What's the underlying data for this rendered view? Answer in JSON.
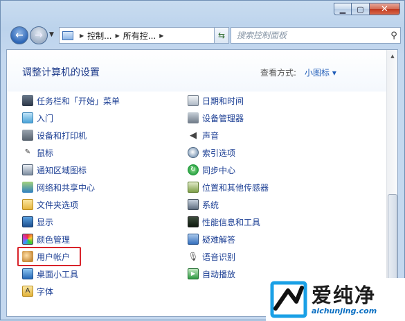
{
  "address": {
    "crumbs": [
      "控制...",
      "所有控..."
    ],
    "search_placeholder": "搜索控制面板"
  },
  "header": {
    "title": "调整计算机的设置",
    "view_by_label": "查看方式:",
    "view_mode": "小图标 ▾"
  },
  "items": {
    "left": [
      {
        "label": "任务栏和「开始」菜单",
        "icon": "taskbar-icon"
      },
      {
        "label": "入门",
        "icon": "getting-started-icon"
      },
      {
        "label": "设备和打印机",
        "icon": "printer-icon"
      },
      {
        "label": "鼠标",
        "icon": "mouse-icon"
      },
      {
        "label": "通知区域图标",
        "icon": "notification-icon"
      },
      {
        "label": "网络和共享中心",
        "icon": "network-icon"
      },
      {
        "label": "文件夹选项",
        "icon": "folder-icon"
      },
      {
        "label": "显示",
        "icon": "display-icon"
      },
      {
        "label": "颜色管理",
        "icon": "color-management-icon"
      },
      {
        "label": "用户帐户",
        "icon": "user-accounts-icon"
      },
      {
        "label": "桌面小工具",
        "icon": "gadgets-icon"
      },
      {
        "label": "字体",
        "icon": "fonts-icon"
      }
    ],
    "right": [
      {
        "label": "日期和时间",
        "icon": "clock-icon"
      },
      {
        "label": "设备管理器",
        "icon": "device-manager-icon"
      },
      {
        "label": "声音",
        "icon": "speaker-icon"
      },
      {
        "label": "索引选项",
        "icon": "indexing-icon"
      },
      {
        "label": "同步中心",
        "icon": "sync-icon"
      },
      {
        "label": "位置和其他传感器",
        "icon": "sensor-icon"
      },
      {
        "label": "系统",
        "icon": "system-icon"
      },
      {
        "label": "性能信息和工具",
        "icon": "performance-icon"
      },
      {
        "label": "疑难解答",
        "icon": "troubleshoot-icon"
      },
      {
        "label": "语音识别",
        "icon": "microphone-icon"
      },
      {
        "label": "自动播放",
        "icon": "autoplay-icon"
      }
    ]
  },
  "watermark": {
    "cn": "爱纯净",
    "en": "aichunjing.com"
  },
  "colors": {
    "link": "#1c3f94",
    "highlight": "#d8232a",
    "title": "#1e3b8a"
  }
}
